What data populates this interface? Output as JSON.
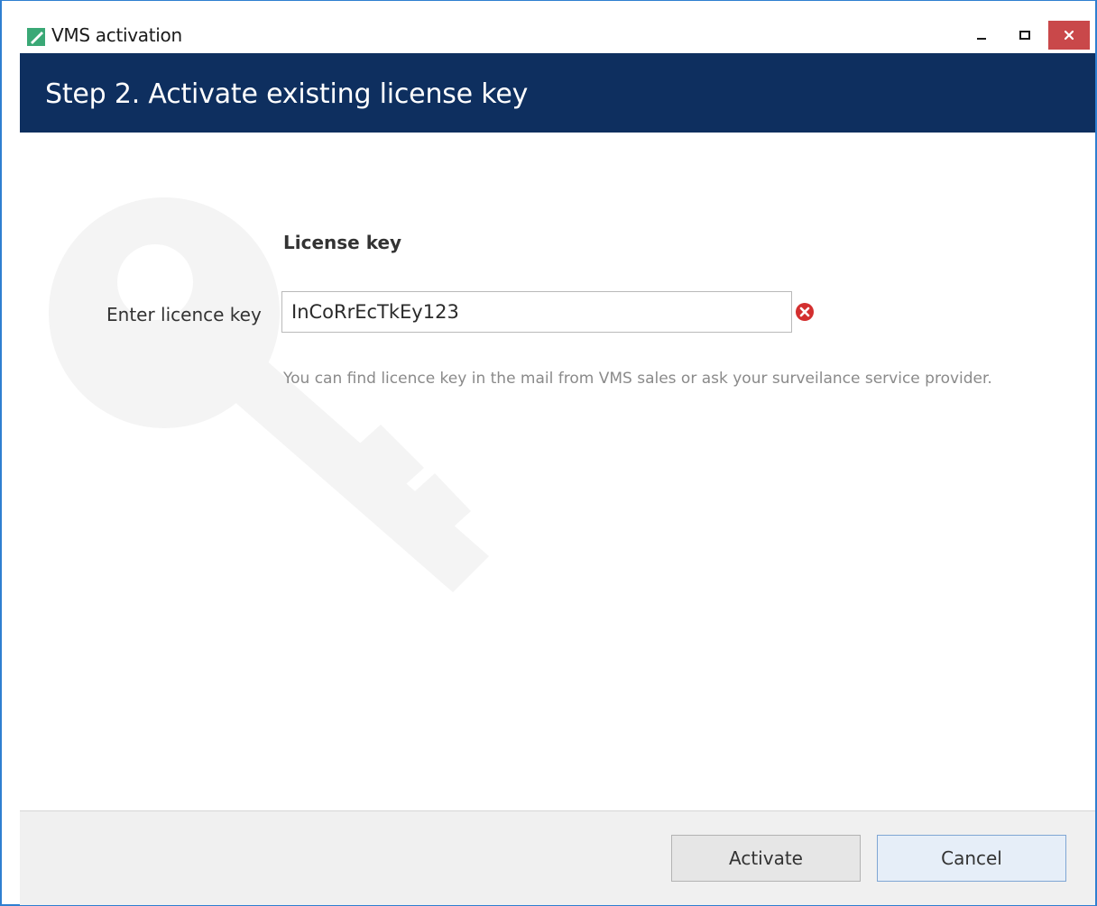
{
  "window": {
    "title": "VMS activation"
  },
  "header": {
    "title": "Step 2. Activate existing license key"
  },
  "form": {
    "section_title": "License key",
    "field_label": "Enter licence key",
    "field_value": "InCoRrEcTkEy123",
    "field_state": "invalid",
    "hint": "You can find licence key in the mail from VMS sales or ask your surveilance service provider."
  },
  "footer": {
    "activate_label": "Activate",
    "cancel_label": "Cancel"
  },
  "colors": {
    "header_bg": "#0e2f5f",
    "window_border": "#2f7fd0",
    "close_button": "#c9484a",
    "error_icon": "#d32f2f",
    "hint_text": "#8a8a8a"
  },
  "icons": {
    "app": "app-icon",
    "minimize": "minimize-icon",
    "maximize": "maximize-icon",
    "close": "close-icon",
    "error": "error-icon",
    "watermark": "key-watermark-icon"
  }
}
